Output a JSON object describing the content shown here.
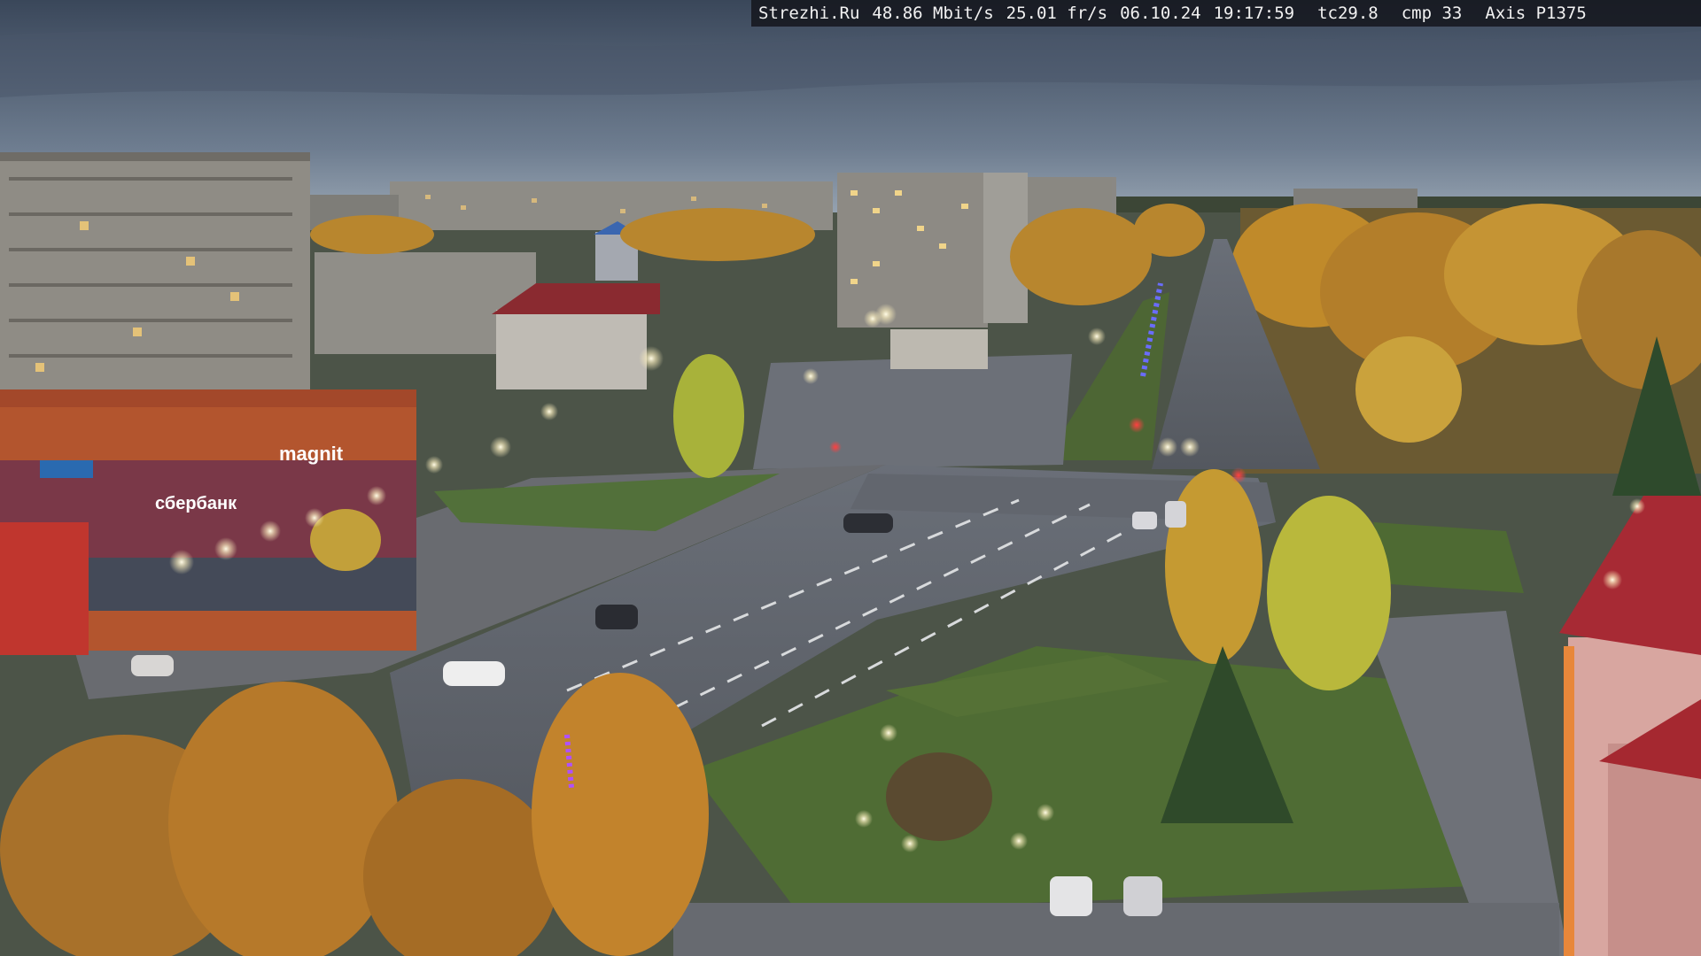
{
  "overlay": {
    "site": "Strezhi.Ru",
    "bitrate": "48.86 Mbit/s",
    "framerate": "25.01 fr/s",
    "date": "06.10.24",
    "time": "19:17:59",
    "tc": "tc29.8",
    "cmp": "cmp 33",
    "camera": "Axis P1375"
  },
  "scene": {
    "storefront_sign_1": "сбербанк",
    "storefront_sign_2": "magnit",
    "colors": {
      "sky_top": "#3d4a5e",
      "sky_horizon": "#8a98a8",
      "asphalt": "#5a5f66",
      "grass": "#4f6a36",
      "foliage_orange": "#c98b2c",
      "foliage_yellow": "#c6b63e",
      "building_grey": "#8c8a84",
      "building_red": "#b0323a",
      "lamp": "#fff6d8"
    }
  }
}
